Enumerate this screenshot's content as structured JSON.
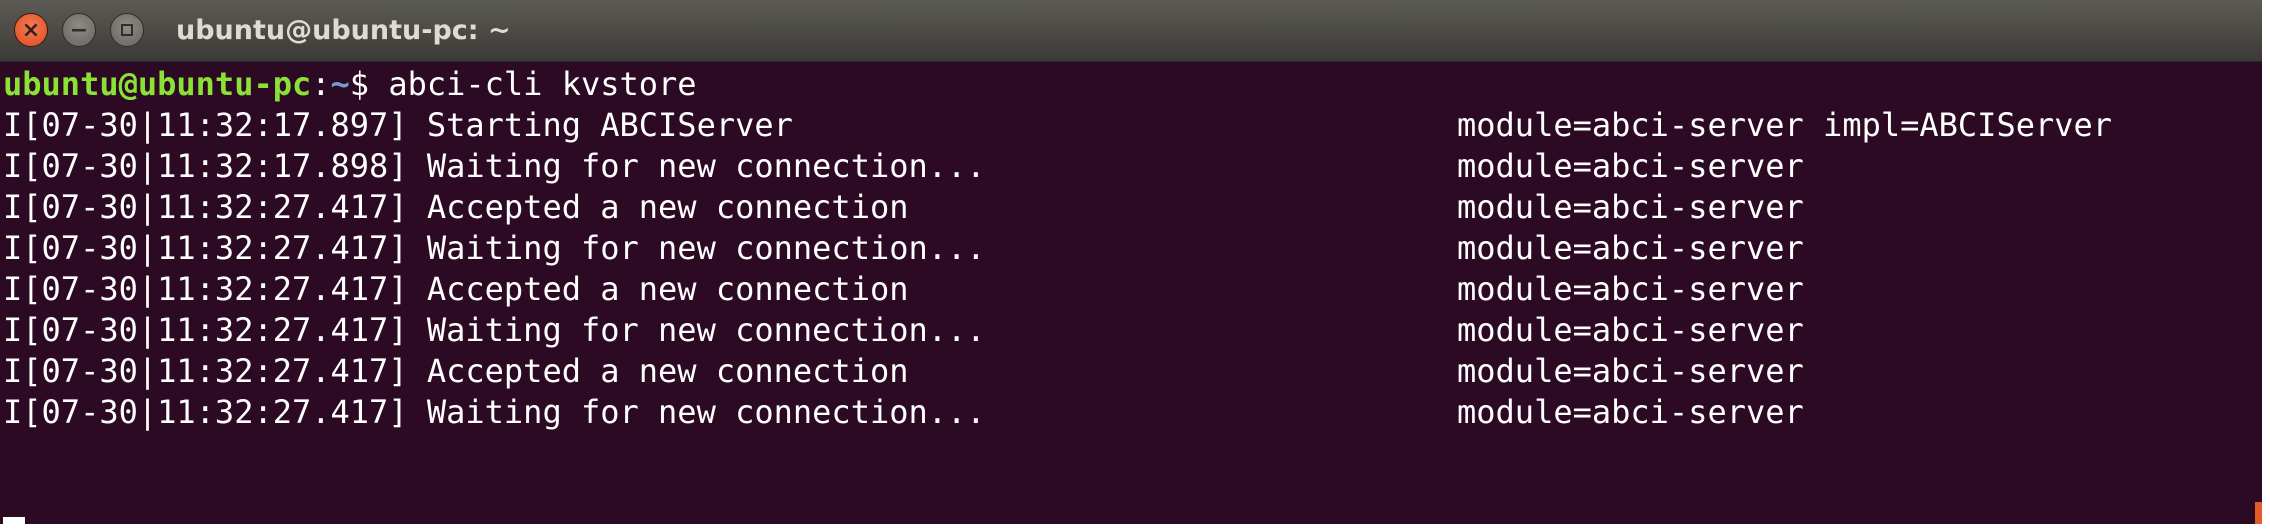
{
  "window": {
    "title": "ubuntu@ubuntu-pc: ~",
    "close_glyph": "×",
    "minimize_glyph": "−"
  },
  "terminal": {
    "prompt": {
      "user_host": "ubuntu@ubuntu-pc",
      "separator": ":",
      "path": "~",
      "symbol": "$",
      "command": " abci-cli kvstore"
    },
    "log_lines": [
      {
        "text": "I[07-30|11:32:17.897] Starting ABCIServer",
        "fields": "module=abci-server impl=ABCIServer"
      },
      {
        "text": "I[07-30|11:32:17.898] Waiting for new connection...",
        "fields": "module=abci-server"
      },
      {
        "text": "I[07-30|11:32:27.417] Accepted a new connection",
        "fields": "module=abci-server"
      },
      {
        "text": "I[07-30|11:32:27.417] Waiting for new connection...",
        "fields": "module=abci-server"
      },
      {
        "text": "I[07-30|11:32:27.417] Accepted a new connection",
        "fields": "module=abci-server"
      },
      {
        "text": "I[07-30|11:32:27.417] Waiting for new connection...",
        "fields": "module=abci-server"
      },
      {
        "text": "I[07-30|11:32:27.417] Accepted a new connection",
        "fields": "module=abci-server"
      },
      {
        "text": "I[07-30|11:32:27.417] Waiting for new connection...",
        "fields": "module=abci-server"
      }
    ]
  },
  "colors": {
    "terminal_bg": "#2c0a23",
    "prompt_user": "#8ae234",
    "prompt_path": "#729fcf",
    "text": "#ffffff",
    "close_button": "#de4c1f"
  }
}
